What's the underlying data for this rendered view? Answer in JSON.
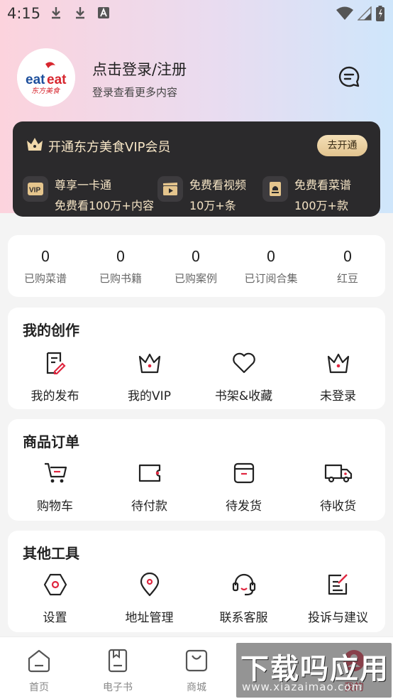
{
  "status_bar": {
    "time": "4:15"
  },
  "profile": {
    "logo_text": "eat eat",
    "logo_sub": "东方美食",
    "login_title": "点击登录/注册",
    "login_subtitle": "登录查看更多内容"
  },
  "vip": {
    "title": "开通东方美食VIP会员",
    "button": "去开通",
    "features": [
      {
        "line1": "尊享一卡通",
        "line2": "免费看100万+内容",
        "icon": "vip-badge-icon"
      },
      {
        "line1": "免费看视频",
        "line2": "10万+条",
        "icon": "video-clapper-icon"
      },
      {
        "line1": "免费看菜谱",
        "line2": "100万+款",
        "icon": "recipe-book-icon"
      }
    ]
  },
  "stats": [
    {
      "value": "0",
      "label": "已购菜谱"
    },
    {
      "value": "0",
      "label": "已购书籍"
    },
    {
      "value": "0",
      "label": "已购案例"
    },
    {
      "value": "0",
      "label": "已订阅合集"
    },
    {
      "value": "0",
      "label": "红豆"
    }
  ],
  "creation": {
    "title": "我的创作",
    "items": [
      {
        "label": "我的发布",
        "icon": "edit-document-icon"
      },
      {
        "label": "我的VIP",
        "icon": "crown-icon"
      },
      {
        "label": "书架&收藏",
        "icon": "heart-icon"
      },
      {
        "label": "未登录",
        "icon": "crown-icon"
      }
    ]
  },
  "orders": {
    "title": "商品订单",
    "items": [
      {
        "label": "购物车",
        "icon": "cart-icon"
      },
      {
        "label": "待付款",
        "icon": "wallet-icon"
      },
      {
        "label": "待发货",
        "icon": "package-icon"
      },
      {
        "label": "待收货",
        "icon": "truck-icon"
      }
    ]
  },
  "tools": {
    "title": "其他工具",
    "items": [
      {
        "label": "设置",
        "icon": "settings-icon"
      },
      {
        "label": "地址管理",
        "icon": "location-pin-icon"
      },
      {
        "label": "联系客服",
        "icon": "headset-icon"
      },
      {
        "label": "投诉与建议",
        "icon": "feedback-icon"
      }
    ]
  },
  "nav": [
    {
      "label": "首页",
      "icon": "home-icon"
    },
    {
      "label": "电子书",
      "icon": "ebook-icon"
    },
    {
      "label": "商城",
      "icon": "shopping-bag-icon"
    },
    {
      "label": "我的",
      "icon": "profile-icon"
    }
  ],
  "watermark": {
    "text": "下载吗应用",
    "url": "www.xiazaimao.com"
  },
  "colors": {
    "accent": "#e0263f",
    "vip_gold": "#f1d9ab",
    "vip_bg": "#2b2a2c"
  }
}
